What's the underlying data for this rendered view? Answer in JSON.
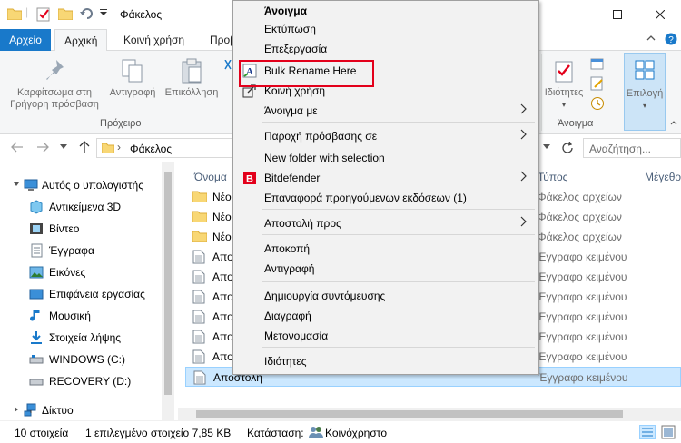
{
  "window": {
    "title": "Φάκελος",
    "minimize_icon": "minimize-icon",
    "maximize_icon": "maximize-icon",
    "close_icon": "close-icon"
  },
  "ribbon_tabs": [
    "Αρχείο",
    "Αρχική",
    "Κοινή χρήση",
    "Προβ"
  ],
  "ribbon": {
    "pin_label_1": "Καρφίτσωμα στη",
    "pin_label_2": "Γρήγορη πρόσβαση",
    "copy_label": "Αντιγραφή",
    "paste_label": "Επικόλληση",
    "clipboard_group": "Πρόχειρο",
    "properties_label": "Ιδιότητες",
    "select_label": "Επιλογή",
    "open_group": "Άνοιγμα"
  },
  "address": {
    "path": "Φάκελος",
    "search_placeholder": "Αναζήτηση..."
  },
  "nav_pane": {
    "items": [
      {
        "label": "Αυτός ο υπολογιστής",
        "icon": "computer-icon"
      },
      {
        "label": "Αντικείμενα 3D",
        "icon": "cube-3d-icon"
      },
      {
        "label": "Βίντεο",
        "icon": "video-icon"
      },
      {
        "label": "Έγγραφα",
        "icon": "documents-icon"
      },
      {
        "label": "Εικόνες",
        "icon": "pictures-icon"
      },
      {
        "label": "Επιφάνεια εργασίας",
        "icon": "desktop-icon"
      },
      {
        "label": "Μουσική",
        "icon": "music-icon"
      },
      {
        "label": "Στοιχεία λήψης",
        "icon": "downloads-icon"
      },
      {
        "label": "WINDOWS (C:)",
        "icon": "drive-icon"
      },
      {
        "label": "RECOVERY (D:)",
        "icon": "drive-icon"
      },
      {
        "label": "Δίκτυο",
        "icon": "network-icon"
      }
    ]
  },
  "file_list": {
    "columns": {
      "name": "Όνομα",
      "type": "Τύπος",
      "size": "Μέγεθο"
    },
    "rows": [
      {
        "name": "Νέο",
        "type": "Φάκελος αρχείων",
        "kind": "folder"
      },
      {
        "name": "Νέο",
        "type": "Φάκελος αρχείων",
        "kind": "folder"
      },
      {
        "name": "Νέο",
        "type": "Φάκελος αρχείων",
        "kind": "folder"
      },
      {
        "name": "Αποσ",
        "type": "Έγγραφο κειμένου",
        "kind": "text"
      },
      {
        "name": "Αποσ",
        "type": "Έγγραφο κειμένου",
        "kind": "text"
      },
      {
        "name": "Αποσ",
        "type": "Έγγραφο κειμένου",
        "kind": "text"
      },
      {
        "name": "Αποσ",
        "type": "Έγγραφο κειμένου",
        "kind": "text"
      },
      {
        "name": "Αποσ",
        "type": "Έγγραφο κειμένου",
        "kind": "text"
      },
      {
        "name": "Αποσ",
        "type": "Έγγραφο κειμένου",
        "kind": "text"
      },
      {
        "name": "Αποστολή",
        "type": "Έγγραφο κειμένου",
        "kind": "text",
        "selected": true
      }
    ]
  },
  "status_bar": {
    "count": "10 στοιχεία",
    "selected": "1 επιλεγμένο στοιχείο  7,85 KB",
    "state_label": "Κατάσταση:",
    "state_value": "Κοινόχρηστο"
  },
  "context_menu": {
    "items": [
      {
        "label": "Άνοιγμα",
        "bold": true
      },
      {
        "label": "Εκτύπωση"
      },
      {
        "label": "Επεξεργασία"
      },
      {
        "label": "Bulk Rename Here",
        "icon": "bulk-rename-icon"
      },
      {
        "label": "Κοινή χρήση",
        "icon": "share-icon"
      },
      {
        "label": "Άνοιγμα με",
        "submenu": true
      },
      {
        "label": "Παροχή πρόσβασης σε",
        "submenu": true
      },
      {
        "label": "New folder with selection"
      },
      {
        "label": "Bitdefender",
        "icon": "bitdefender-icon",
        "submenu": true
      },
      {
        "label": "Επαναφορά προηγούμενων εκδόσεων (1)"
      },
      {
        "label": "Αποστολή προς",
        "submenu": true
      },
      {
        "label": "Αποκοπή"
      },
      {
        "label": "Αντιγραφή"
      },
      {
        "label": "Δημιουργία συντόμευσης"
      },
      {
        "label": "Διαγραφή"
      },
      {
        "label": "Μετονομασία"
      },
      {
        "label": "Ιδιότητες"
      }
    ]
  },
  "colors": {
    "file_tab": "#1979ca",
    "selection": "#cce8ff",
    "highlight_box": "#e3001b",
    "bitdefender": "#e3001b"
  }
}
